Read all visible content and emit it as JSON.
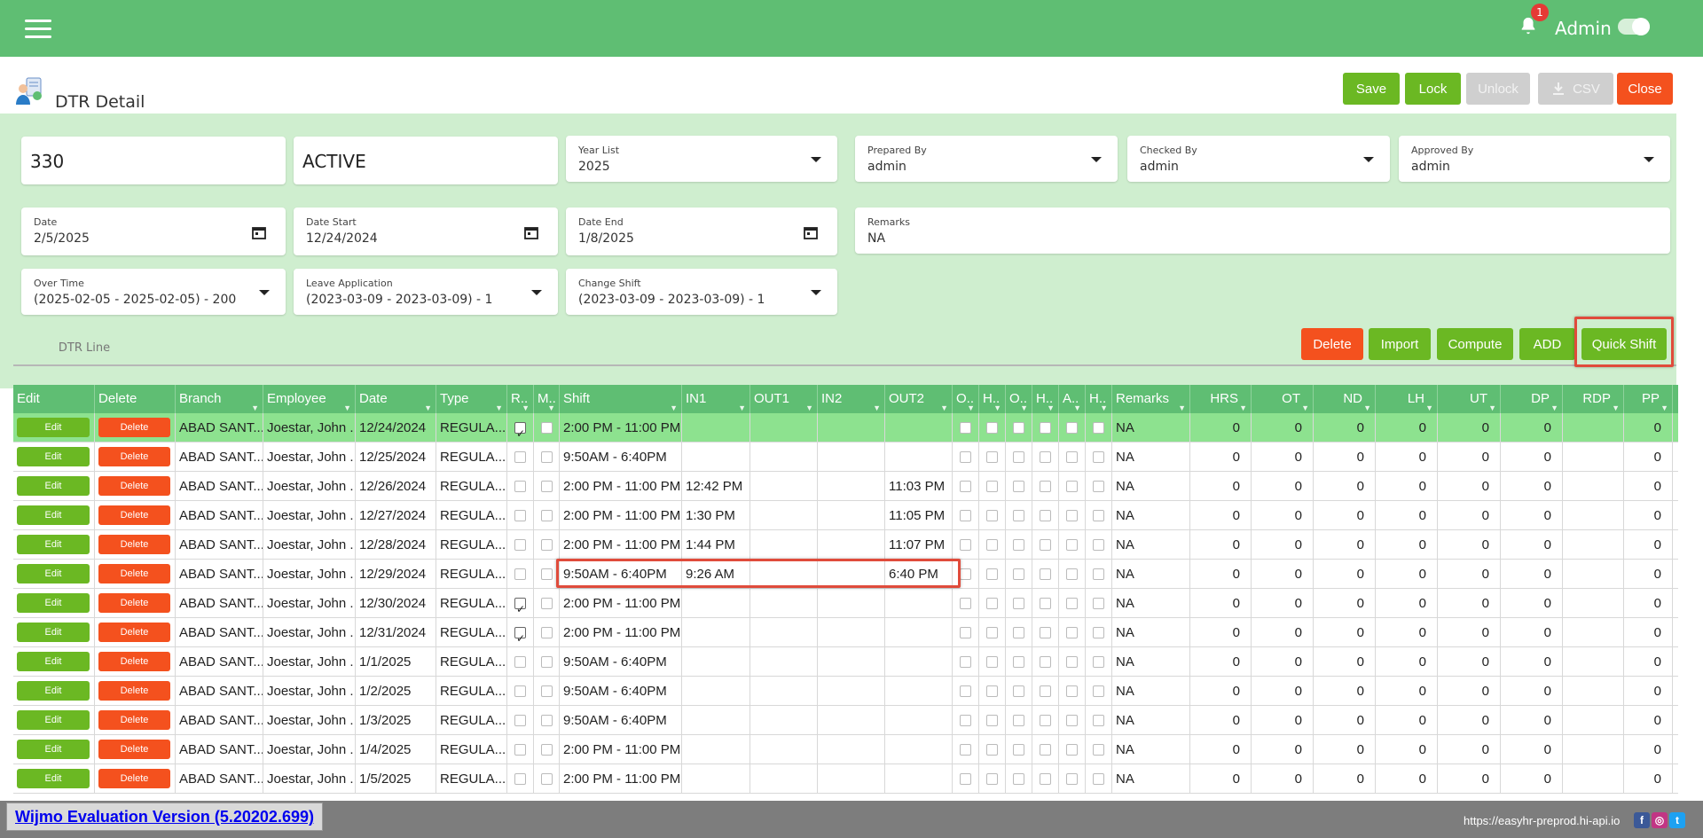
{
  "topbar": {
    "notification_count": "1",
    "user_name": "Admin"
  },
  "page": {
    "title": "DTR Detail"
  },
  "toolbar": {
    "save": "Save",
    "lock": "Lock",
    "unlock": "Unlock",
    "csv": "CSV",
    "close": "Close"
  },
  "form": {
    "id_value": "330",
    "status_value": "ACTIVE",
    "year_list": {
      "label": "Year List",
      "value": "2025"
    },
    "prepared_by": {
      "label": "Prepared By",
      "value": "admin"
    },
    "checked_by": {
      "label": "Checked By",
      "value": "admin"
    },
    "approved_by": {
      "label": "Approved By",
      "value": "admin"
    },
    "date": {
      "label": "Date",
      "value": "2/5/2025"
    },
    "date_start": {
      "label": "Date Start",
      "value": "12/24/2024"
    },
    "date_end": {
      "label": "Date End",
      "value": "1/8/2025"
    },
    "remarks": {
      "label": "Remarks",
      "value": "NA"
    },
    "over_time": {
      "label": "Over Time",
      "value": "(2025-02-05 - 2025-02-05) - 200"
    },
    "leave_application": {
      "label": "Leave Application",
      "value": "(2023-03-09 - 2023-03-09) - 1"
    },
    "change_shift": {
      "label": "Change Shift",
      "value": "(2023-03-09 - 2023-03-09) - 1"
    }
  },
  "tabs": {
    "dtr_line": "DTR Line"
  },
  "actions": {
    "delete": "Delete",
    "import": "Import",
    "compute": "Compute",
    "add": "ADD",
    "quick_shift": "Quick Shift"
  },
  "grid": {
    "columns": [
      "Edit",
      "Delete",
      "Branch",
      "Employee",
      "Date",
      "Type",
      "R..",
      "M..",
      "Shift",
      "IN1",
      "OUT1",
      "IN2",
      "OUT2",
      "O..",
      "H..",
      "O..",
      "H..",
      "A..",
      "H..",
      "Remarks",
      "HRS",
      "OT",
      "ND",
      "LH",
      "UT",
      "DP",
      "RDP",
      "PP"
    ],
    "edit_label": "Edit",
    "delete_label": "Delete",
    "rows": [
      {
        "branch": "ABAD SANT...",
        "employee": "Joestar, John .",
        "date": "12/24/2024",
        "type": "REGULA...",
        "r": true,
        "shift": "2:00 PM - 11:00 PM",
        "in1": "",
        "out1": "",
        "in2": "",
        "out2": "",
        "remarks": "NA",
        "hrs": "0",
        "ot": "0",
        "nd": "0",
        "lh": "0",
        "ut": "0",
        "dp": "0",
        "rdp": "",
        "pp": "0"
      },
      {
        "branch": "ABAD SANT...",
        "employee": "Joestar, John .",
        "date": "12/25/2024",
        "type": "REGULA...",
        "r": false,
        "shift": "9:50AM - 6:40PM",
        "in1": "",
        "out1": "",
        "in2": "",
        "out2": "",
        "remarks": "NA",
        "hrs": "0",
        "ot": "0",
        "nd": "0",
        "lh": "0",
        "ut": "0",
        "dp": "0",
        "rdp": "",
        "pp": "0"
      },
      {
        "branch": "ABAD SANT...",
        "employee": "Joestar, John .",
        "date": "12/26/2024",
        "type": "REGULA...",
        "r": false,
        "shift": "2:00 PM - 11:00 PM",
        "in1": "12:42 PM",
        "out1": "",
        "in2": "",
        "out2": "11:03 PM",
        "remarks": "NA",
        "hrs": "0",
        "ot": "0",
        "nd": "0",
        "lh": "0",
        "ut": "0",
        "dp": "0",
        "rdp": "",
        "pp": "0"
      },
      {
        "branch": "ABAD SANT...",
        "employee": "Joestar, John .",
        "date": "12/27/2024",
        "type": "REGULA...",
        "r": false,
        "shift": "2:00 PM - 11:00 PM",
        "in1": "1:30 PM",
        "out1": "",
        "in2": "",
        "out2": "11:05 PM",
        "remarks": "NA",
        "hrs": "0",
        "ot": "0",
        "nd": "0",
        "lh": "0",
        "ut": "0",
        "dp": "0",
        "rdp": "",
        "pp": "0"
      },
      {
        "branch": "ABAD SANT...",
        "employee": "Joestar, John .",
        "date": "12/28/2024",
        "type": "REGULA...",
        "r": false,
        "shift": "2:00 PM - 11:00 PM",
        "in1": "1:44 PM",
        "out1": "",
        "in2": "",
        "out2": "11:07 PM",
        "remarks": "NA",
        "hrs": "0",
        "ot": "0",
        "nd": "0",
        "lh": "0",
        "ut": "0",
        "dp": "0",
        "rdp": "",
        "pp": "0"
      },
      {
        "branch": "ABAD SANT...",
        "employee": "Joestar, John .",
        "date": "12/29/2024",
        "type": "REGULA...",
        "r": false,
        "shift": "9:50AM - 6:40PM",
        "in1": "9:26 AM",
        "out1": "",
        "in2": "",
        "out2": "6:40 PM",
        "remarks": "NA",
        "hrs": "0",
        "ot": "0",
        "nd": "0",
        "lh": "0",
        "ut": "0",
        "dp": "0",
        "rdp": "",
        "pp": "0"
      },
      {
        "branch": "ABAD SANT...",
        "employee": "Joestar, John .",
        "date": "12/30/2024",
        "type": "REGULA...",
        "r": true,
        "shift": "2:00 PM - 11:00 PM",
        "in1": "",
        "out1": "",
        "in2": "",
        "out2": "",
        "remarks": "NA",
        "hrs": "0",
        "ot": "0",
        "nd": "0",
        "lh": "0",
        "ut": "0",
        "dp": "0",
        "rdp": "",
        "pp": "0"
      },
      {
        "branch": "ABAD SANT...",
        "employee": "Joestar, John .",
        "date": "12/31/2024",
        "type": "REGULA...",
        "r": true,
        "shift": "2:00 PM - 11:00 PM",
        "in1": "",
        "out1": "",
        "in2": "",
        "out2": "",
        "remarks": "NA",
        "hrs": "0",
        "ot": "0",
        "nd": "0",
        "lh": "0",
        "ut": "0",
        "dp": "0",
        "rdp": "",
        "pp": "0"
      },
      {
        "branch": "ABAD SANT...",
        "employee": "Joestar, John .",
        "date": "1/1/2025",
        "type": "REGULA...",
        "r": false,
        "shift": "9:50AM - 6:40PM",
        "in1": "",
        "out1": "",
        "in2": "",
        "out2": "",
        "remarks": "NA",
        "hrs": "0",
        "ot": "0",
        "nd": "0",
        "lh": "0",
        "ut": "0",
        "dp": "0",
        "rdp": "",
        "pp": "0"
      },
      {
        "branch": "ABAD SANT...",
        "employee": "Joestar, John .",
        "date": "1/2/2025",
        "type": "REGULA...",
        "r": false,
        "shift": "9:50AM - 6:40PM",
        "in1": "",
        "out1": "",
        "in2": "",
        "out2": "",
        "remarks": "NA",
        "hrs": "0",
        "ot": "0",
        "nd": "0",
        "lh": "0",
        "ut": "0",
        "dp": "0",
        "rdp": "",
        "pp": "0"
      },
      {
        "branch": "ABAD SANT...",
        "employee": "Joestar, John .",
        "date": "1/3/2025",
        "type": "REGULA...",
        "r": false,
        "shift": "9:50AM - 6:40PM",
        "in1": "",
        "out1": "",
        "in2": "",
        "out2": "",
        "remarks": "NA",
        "hrs": "0",
        "ot": "0",
        "nd": "0",
        "lh": "0",
        "ut": "0",
        "dp": "0",
        "rdp": "",
        "pp": "0"
      },
      {
        "branch": "ABAD SANT...",
        "employee": "Joestar, John .",
        "date": "1/4/2025",
        "type": "REGULA...",
        "r": false,
        "shift": "2:00 PM - 11:00 PM",
        "in1": "",
        "out1": "",
        "in2": "",
        "out2": "",
        "remarks": "NA",
        "hrs": "0",
        "ot": "0",
        "nd": "0",
        "lh": "0",
        "ut": "0",
        "dp": "0",
        "rdp": "",
        "pp": "0"
      },
      {
        "branch": "ABAD SANT...",
        "employee": "Joestar, John .",
        "date": "1/5/2025",
        "type": "REGULA...",
        "r": false,
        "shift": "2:00 PM - 11:00 PM",
        "in1": "",
        "out1": "",
        "in2": "",
        "out2": "",
        "remarks": "NA",
        "hrs": "0",
        "ot": "0",
        "nd": "0",
        "lh": "0",
        "ut": "0",
        "dp": "0",
        "rdp": "",
        "pp": "0"
      }
    ]
  },
  "footer": {
    "wijmo": "Wijmo Evaluation Version (5.20202.699)",
    "url": "https://easyhr-preprod.hi-api.io"
  },
  "icons": [
    "menu-icon",
    "bell-icon",
    "moon-icon",
    "dtr-page-icon",
    "calendar-icon",
    "chevron-down-icon",
    "filter-icon",
    "download-icon",
    "facebook-icon",
    "instagram-icon",
    "twitter-icon"
  ],
  "colors": {
    "brand_green": "#5fbe73",
    "form_bg": "#cfeecf",
    "button_green": "#6bb823",
    "button_red": "#f4511e",
    "selected_row": "#8de28f",
    "highlight_border": "#e04b3b"
  }
}
